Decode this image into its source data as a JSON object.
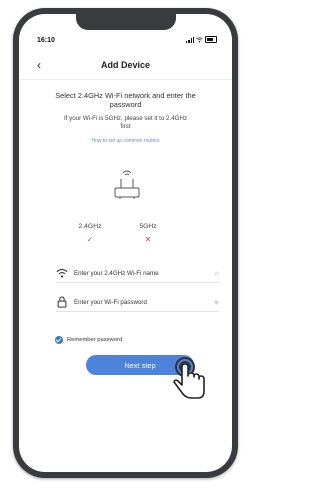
{
  "status_bar": {
    "time": "16:10"
  },
  "header": {
    "back_glyph": "‹",
    "title": "Add Device"
  },
  "instructions": {
    "main": "Select 2.4GHz Wi-Fi network and enter the password",
    "warning": "If your Wi-Fi is 5GHz, please set it to 2.4GHz first",
    "link": "How to set up common routers"
  },
  "bands": {
    "band_24": {
      "label": "2.4GHz",
      "mark": "✓"
    },
    "band_5": {
      "label": "5GHz",
      "mark": "✕"
    }
  },
  "wifi_field": {
    "placeholder": "Enter your 2.4GHz Wi-Fi name",
    "tail": "⇄"
  },
  "password_field": {
    "placeholder": "Enter your Wi-Fi password",
    "tail": "◉"
  },
  "remember": {
    "label": "Remember password",
    "checked": true
  },
  "next_button": {
    "label": "Next step"
  },
  "colors": {
    "accent": "#4e83dc",
    "check_ok": "#4e83dc",
    "cross_bad": "#e0413f",
    "link": "#6d8fd0",
    "phone_frame": "#3a3b3f"
  },
  "icons": [
    "signal-icon",
    "wifi-status-icon",
    "battery-icon",
    "router-icon",
    "wifi-icon",
    "lock-icon",
    "eye-icon",
    "hand-pointer-icon"
  ]
}
